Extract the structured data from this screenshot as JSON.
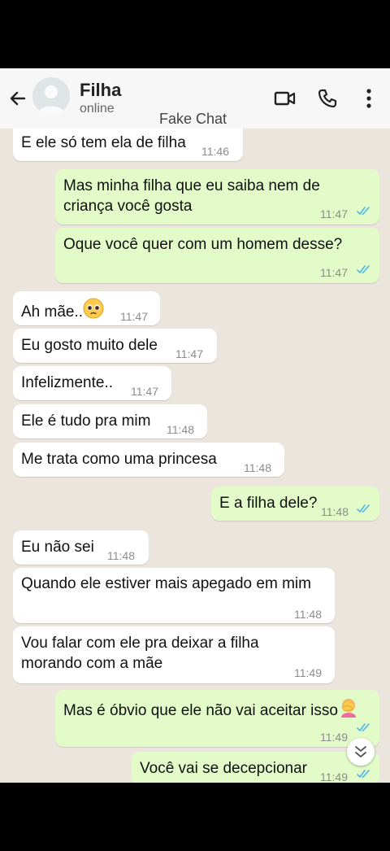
{
  "header": {
    "name": "Filha",
    "status": "online",
    "overlay": "Fake Chat",
    "icons": [
      "back-arrow-icon",
      "avatar",
      "video-call-icon",
      "phone-icon",
      "more-options-icon"
    ]
  },
  "messages": [
    {
      "dir": "in",
      "text": "E ele só tem ela de filha",
      "time": "11:46"
    },
    {
      "dir": "out",
      "line1": "Mas minha filha que eu saiba nem de",
      "line2": "criança você gosta",
      "time": "11:47",
      "ticks": "read"
    },
    {
      "dir": "out",
      "text": "Oque você quer com um homem desse?",
      "time": "11:47",
      "ticks": "read"
    },
    {
      "dir": "in",
      "text": "Ah mãe..",
      "emoji": "pleading-face",
      "time": "11:47"
    },
    {
      "dir": "in",
      "text": "Eu gosto muito dele",
      "time": "11:47"
    },
    {
      "dir": "in",
      "text": "Infelizmente..",
      "time": "11:47"
    },
    {
      "dir": "in",
      "text": "Ele é tudo pra mim",
      "time": "11:48"
    },
    {
      "dir": "in",
      "text": "Me trata como uma princesa",
      "time": "11:48"
    },
    {
      "dir": "out",
      "text": "E a filha dele?",
      "time": "11:48",
      "ticks": "read"
    },
    {
      "dir": "in",
      "text": "Eu não sei",
      "time": "11:48"
    },
    {
      "dir": "in",
      "text": "Quando ele estiver mais apegado em mim",
      "time": "11:48"
    },
    {
      "dir": "in",
      "line1": "Vou falar com ele pra deixar a filha",
      "line2": "morando com a mãe",
      "time": "11:49"
    },
    {
      "dir": "out",
      "text": "Mas é óbvio que ele não vai aceitar isso",
      "emoji": "woman-facepalming",
      "time": "11:49",
      "ticks": "read"
    },
    {
      "dir": "out",
      "text": "Você vai se decepcionar",
      "time": "11:49",
      "ticks": "read"
    }
  ],
  "colors": {
    "header_bg": "#f7f7f7",
    "chat_bg": "#ece5dd",
    "incoming_bubble": "#ffffff",
    "outgoing_bubble": "#e2fbc8",
    "read_ticks": "#4fb6ec"
  },
  "scroll_button": {
    "icon": "double-chevron-down-icon"
  }
}
